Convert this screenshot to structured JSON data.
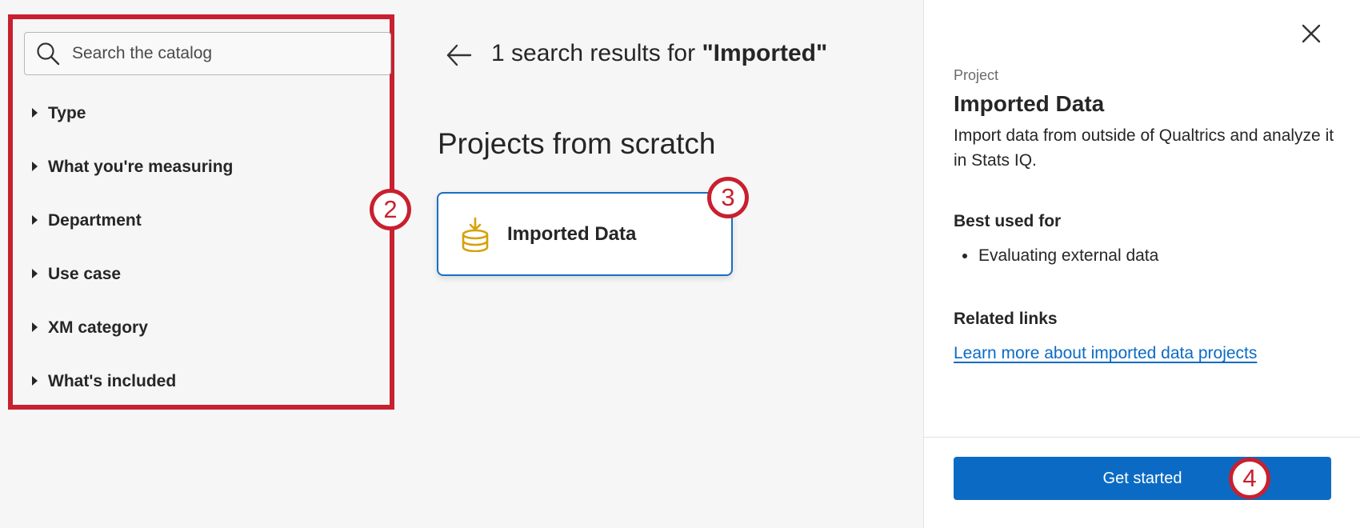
{
  "sidebar": {
    "search_placeholder": "Search the catalog",
    "filters": [
      {
        "label": "Type"
      },
      {
        "label": "What you're measuring"
      },
      {
        "label": "Department"
      },
      {
        "label": "Use case"
      },
      {
        "label": "XM category"
      },
      {
        "label": "What's included"
      }
    ]
  },
  "annotations": {
    "step2": "2",
    "step3": "3",
    "step4": "4",
    "color": "#c8202f"
  },
  "main": {
    "results_prefix": "1 search results for ",
    "results_query": "\"Imported\"",
    "section_title": "Projects from scratch",
    "card": {
      "title": "Imported Data",
      "icon": "database-import-icon"
    }
  },
  "panel": {
    "kicker": "Project",
    "title": "Imported Data",
    "description": "Import data from outside of Qualtrics and analyze it in Stats IQ.",
    "best_used_heading": "Best used for",
    "best_used_items": [
      "Evaluating external data"
    ],
    "related_heading": "Related links",
    "related_link": "Learn more about imported data projects",
    "cta_label": "Get started"
  },
  "colors": {
    "accent": "#0b6bc4",
    "card_border": "#1b6ec2",
    "icon_gold": "#d5a20b"
  }
}
